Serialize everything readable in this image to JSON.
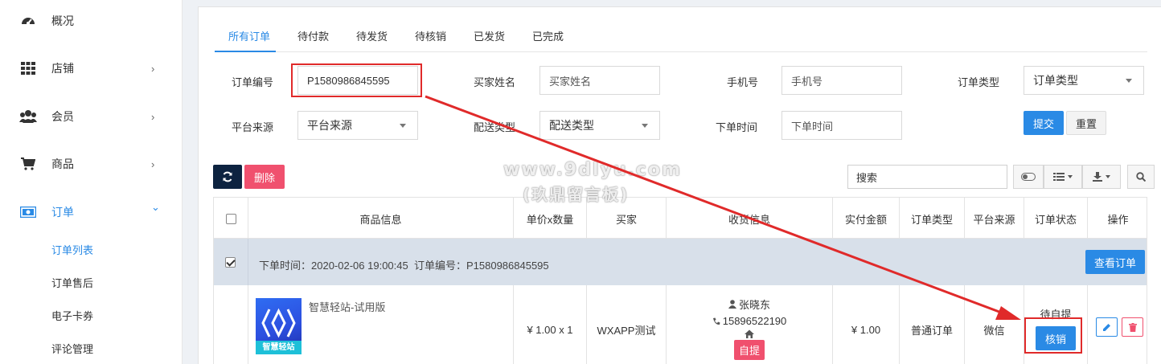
{
  "sidebar": {
    "items": [
      {
        "label": "概况",
        "has_children": false
      },
      {
        "label": "店铺",
        "has_children": true
      },
      {
        "label": "会员",
        "has_children": true
      },
      {
        "label": "商品",
        "has_children": true
      },
      {
        "label": "订单",
        "has_children": true,
        "expanded": true
      }
    ],
    "order_subitems": [
      {
        "label": "订单列表",
        "active": true
      },
      {
        "label": "订单售后"
      },
      {
        "label": "电子卡券"
      },
      {
        "label": "评论管理"
      }
    ],
    "chevron_right": "›",
    "chevron_down": "⌄"
  },
  "tabs": [
    {
      "label": "所有订单",
      "active": true
    },
    {
      "label": "待付款"
    },
    {
      "label": "待发货"
    },
    {
      "label": "待核销"
    },
    {
      "label": "已发货"
    },
    {
      "label": "已完成"
    }
  ],
  "filters": {
    "order_no_label": "订单编号",
    "order_no_value": "P1580986845595",
    "buyer_label": "买家姓名",
    "buyer_placeholder": "买家姓名",
    "phone_label": "手机号",
    "phone_placeholder": "手机号",
    "order_type_label": "订单类型",
    "order_type_value": "订单类型",
    "platform_label": "平台来源",
    "platform_value": "平台来源",
    "delivery_label": "配送类型",
    "delivery_value": "配送类型",
    "time_label": "下单时间",
    "time_placeholder": "下单时间",
    "submit": "提交",
    "reset": "重置"
  },
  "toolbar": {
    "refresh_icon": "refresh-icon",
    "delete": "删除",
    "search_placeholder": "搜索"
  },
  "table": {
    "headers": [
      "商品信息",
      "单价x数量",
      "买家",
      "收货信息",
      "实付金额",
      "订单类型",
      "平台来源",
      "订单状态",
      "操作"
    ],
    "group": {
      "time_label": "下单时间：",
      "time_value": "2020-02-06 19:00:45",
      "order_no_label": "订单编号：",
      "order_no_value": "P1580986845595",
      "view_button": "查看订单"
    },
    "row": {
      "product_name": "智慧轻站-试用版",
      "product_thumb_text": "智慧轻站",
      "price_qty": "¥ 1.00 x 1",
      "buyer": "WXAPP测试",
      "recipient_name": "张晓东",
      "recipient_phone": "15896522190",
      "pickup_tag": "自提",
      "paid_amount": "¥ 1.00",
      "order_type": "普通订单",
      "platform": "微信",
      "status": "待自提",
      "verify_button": "核销"
    }
  },
  "watermark": {
    "line1": "www.9dlyu.com",
    "line2": "(玖鼎留言板)"
  },
  "colors": {
    "accent": "#2a8ae5",
    "danger": "#f0506e",
    "dark": "#0d2340",
    "annotation_red": "#e02a2a",
    "group_row_bg": "#d8e0ea"
  }
}
